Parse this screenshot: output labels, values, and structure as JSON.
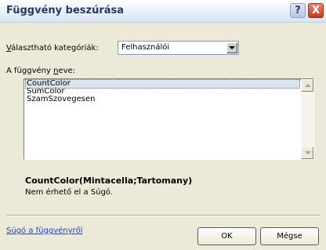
{
  "dialog": {
    "title": "Függvény beszúrása",
    "help_glyph": "?",
    "close_glyph": "X"
  },
  "category": {
    "label_prefix": "V",
    "label_rest": "álasztható kategóriák:",
    "selected": "Felhasználói"
  },
  "function_list": {
    "label_prefix": "A függvény ",
    "label_accel": "n",
    "label_rest": "eve:",
    "items": [
      "CountColor",
      "SumColor",
      "SzamSzovegesen"
    ],
    "selected_index": 0
  },
  "signature": "CountColor(Mintacella;Tartomany)",
  "description": "Nem érhető el a Súgó.",
  "footer": {
    "help_link": "Súgó a függvényről",
    "ok_label": "OK",
    "cancel_label": "Mégse"
  },
  "colors": {
    "title_text": "#243a66",
    "dialog_bg": "#ece9d8",
    "close_red": "#c43a1f",
    "link_blue": "#1f3fbf"
  }
}
